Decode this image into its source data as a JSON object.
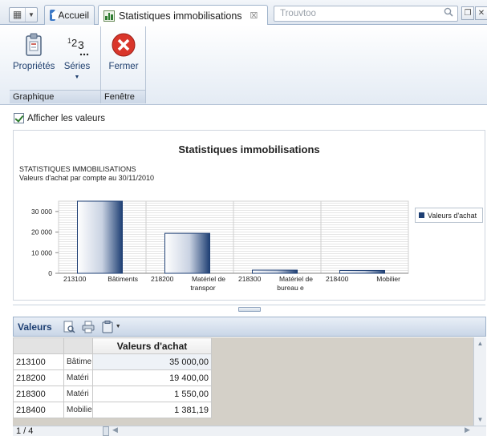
{
  "tabbar": {
    "home_tab": "Accueil",
    "active_tab": "Statistiques immobilisations",
    "close_glyph": "☒",
    "search_placeholder": "Trouvtoo"
  },
  "ribbon": {
    "groups": [
      {
        "label": "Graphique",
        "buttons": [
          {
            "label": "Propriétés",
            "icon": "clipboard-properties-icon"
          },
          {
            "label": "Séries",
            "icon": "series-123-icon",
            "has_dropdown": true
          }
        ]
      },
      {
        "label": "Fenêtre",
        "buttons": [
          {
            "label": "Fermer",
            "icon": "close-red-x-icon"
          }
        ]
      }
    ]
  },
  "options": {
    "show_values_label": "Afficher les valeurs",
    "show_values_checked": true
  },
  "chart": {
    "title": "Statistiques immobilisations",
    "subtitle_line1": "STATISTIQUES IMMOBILISATIONS",
    "subtitle_line2": "Valeurs d'achat par compte au 30/11/2010",
    "legend_label": "Valeurs d'achat",
    "bar_color": "#1e3f74"
  },
  "chart_data": {
    "type": "bar",
    "title": "Statistiques immobilisations",
    "categories": [
      {
        "code": "213100",
        "name": "Bâtiments"
      },
      {
        "code": "218200",
        "name": "Matériel de transpor"
      },
      {
        "code": "218300",
        "name": "Matériel de bureau e"
      },
      {
        "code": "218400",
        "name": "Mobilier"
      }
    ],
    "category_label_lines": [
      [
        "213100",
        "Bâtiments",
        ""
      ],
      [
        "218200",
        "Matériel de",
        "transpor"
      ],
      [
        "218300",
        "Matériel de",
        "bureau e"
      ],
      [
        "218400",
        "Mobilier",
        ""
      ]
    ],
    "series": [
      {
        "name": "Valeurs d'achat",
        "values": [
          35000,
          19400,
          1550,
          1381.19
        ]
      }
    ],
    "yticks": [
      0,
      10000,
      20000,
      30000
    ],
    "ytick_labels": [
      "0",
      "10 000",
      "20 000",
      "30 000"
    ],
    "ylim": [
      0,
      35000
    ],
    "grid": true,
    "legend": "right"
  },
  "values_panel": {
    "title": "Valeurs",
    "column_header": "Valeurs d'achat",
    "rows": [
      {
        "code": "213100",
        "label": "Bâtime",
        "value": "35 000,00"
      },
      {
        "code": "218200",
        "label": "Matéri",
        "value": "19 400,00"
      },
      {
        "code": "218300",
        "label": "Matéri",
        "value": "1 550,00"
      },
      {
        "code": "218400",
        "label": "Mobilie",
        "value": "1 381,19"
      }
    ],
    "pager": "1 / 4"
  }
}
